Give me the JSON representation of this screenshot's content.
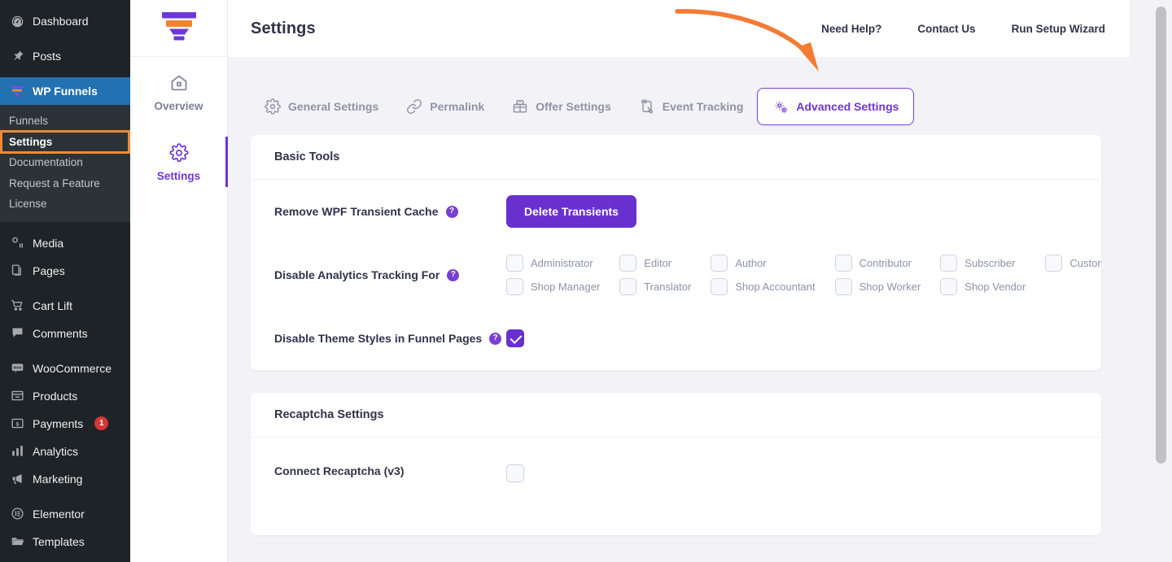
{
  "wp_sidebar": {
    "items": [
      {
        "label": "Dashboard",
        "icon": "dashboard-icon",
        "active": false
      },
      {
        "label": "Posts",
        "icon": "pin-icon",
        "active": false
      },
      {
        "label": "WP Funnels",
        "icon": "funnel-icon",
        "active": true
      }
    ],
    "submenu": [
      {
        "label": "Funnels",
        "state": "normal"
      },
      {
        "label": "Settings",
        "state": "current-highlighted"
      },
      {
        "label": "Documentation",
        "state": "normal"
      },
      {
        "label": "Request a Feature",
        "state": "normal"
      },
      {
        "label": "License",
        "state": "normal"
      }
    ],
    "items_after": [
      {
        "label": "Media",
        "icon": "media-icon",
        "badge": ""
      },
      {
        "label": "Pages",
        "icon": "pages-icon",
        "badge": ""
      },
      {
        "label": "Cart Lift",
        "icon": "cart-icon",
        "badge": ""
      },
      {
        "label": "Comments",
        "icon": "comment-icon",
        "badge": ""
      },
      {
        "label": "WooCommerce",
        "icon": "woo-icon",
        "badge": ""
      },
      {
        "label": "Products",
        "icon": "products-icon",
        "badge": ""
      },
      {
        "label": "Payments",
        "icon": "payments-icon",
        "badge": "1"
      },
      {
        "label": "Analytics",
        "icon": "analytics-icon",
        "badge": ""
      },
      {
        "label": "Marketing",
        "icon": "megaphone-icon",
        "badge": ""
      },
      {
        "label": "Elementor",
        "icon": "elementor-icon",
        "badge": ""
      },
      {
        "label": "Templates",
        "icon": "folder-icon",
        "badge": ""
      }
    ],
    "highlight_color": "#f08a36",
    "active_color": "#2271b1",
    "badge_color": "#d63638"
  },
  "rail": {
    "logo_icon": "wpfunnels-logo-icon",
    "items": [
      {
        "label": "Overview",
        "icon": "home-icon",
        "active": false
      },
      {
        "label": "Settings",
        "icon": "gear-icon",
        "active": true
      }
    ],
    "active_color": "#6f35d4"
  },
  "header": {
    "title": "Settings",
    "links": [
      {
        "label": "Need Help?"
      },
      {
        "label": "Contact Us"
      },
      {
        "label": "Run Setup Wizard"
      }
    ]
  },
  "tabs": [
    {
      "label": "General Settings",
      "icon": "gear-icon",
      "active": false
    },
    {
      "label": "Permalink",
      "icon": "link-icon",
      "active": false
    },
    {
      "label": "Offer Settings",
      "icon": "gift-icon",
      "active": false
    },
    {
      "label": "Event Tracking",
      "icon": "swap-flow-icon",
      "active": false
    },
    {
      "label": "Advanced Settings",
      "icon": "double-gear-icon",
      "active": true
    }
  ],
  "annotation": {
    "type": "curved-arrow",
    "color": "#f47b34",
    "points_to": "Advanced Settings"
  },
  "cards": [
    {
      "title": "Basic Tools",
      "rows": [
        {
          "type": "button",
          "label": "Remove WPF Transient Cache",
          "help": "?",
          "button_label": "Delete Transients"
        },
        {
          "type": "role-grid",
          "label": "Disable Analytics Tracking For",
          "help": "?",
          "roles": [
            {
              "label": "Administrator",
              "checked": false
            },
            {
              "label": "Editor",
              "checked": false
            },
            {
              "label": "Author",
              "checked": false
            },
            {
              "label": "Contributor",
              "checked": false
            },
            {
              "label": "Subscriber",
              "checked": false
            },
            {
              "label": "Customer",
              "checked": false
            },
            {
              "label": "Shop Manager",
              "checked": false
            },
            {
              "label": "Translator",
              "checked": false
            },
            {
              "label": "Shop Accountant",
              "checked": false
            },
            {
              "label": "Shop Worker",
              "checked": false
            },
            {
              "label": "Shop Vendor",
              "checked": false
            }
          ]
        },
        {
          "type": "checkbox",
          "label": "Disable Theme Styles in Funnel Pages",
          "help": "?",
          "checked": true
        }
      ]
    },
    {
      "title": "Recaptcha Settings",
      "rows": [
        {
          "type": "checkbox",
          "label": "Connect Recaptcha (v3)",
          "help": "",
          "checked": false
        }
      ]
    }
  ],
  "colors": {
    "brand_purple": "#6930d0",
    "accent_orange": "#f47b34",
    "page_bg": "#f3f2f7",
    "text_dark": "#30334a",
    "text_muted": "#8d93a6"
  }
}
